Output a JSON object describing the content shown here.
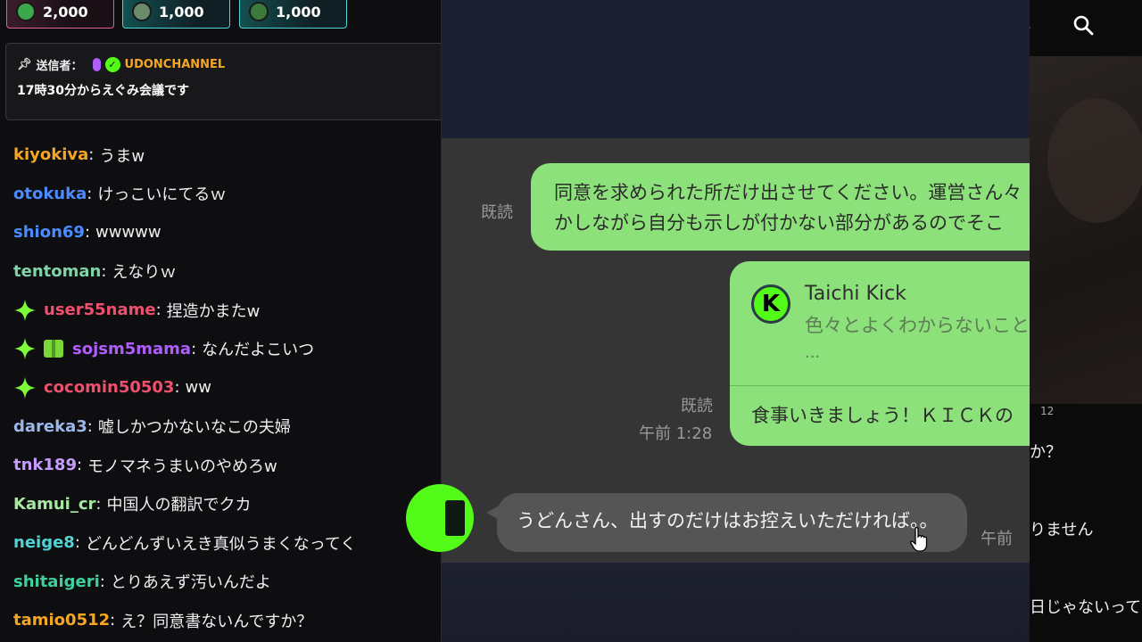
{
  "gifts": [
    {
      "amount": "2,000",
      "icon": "avatar-icon"
    },
    {
      "amount": "1,000",
      "icon": "avatar-icon"
    },
    {
      "amount": "1,000",
      "icon": "avatar-icon"
    }
  ],
  "pinned": {
    "label": "送信者：",
    "sender": "UDONCHANNEL",
    "text": "17時30分からえぐみ会議です"
  },
  "messages": [
    {
      "user": "kiyokiva",
      "color": "#f5a623",
      "text": "うまw",
      "badges": []
    },
    {
      "user": "otokuka",
      "color": "#4a8cff",
      "text": "けっこいにてるｗ",
      "badges": []
    },
    {
      "user": "shion69",
      "color": "#4a8cff",
      "text": "wwwww",
      "badges": []
    },
    {
      "user": "tentoman",
      "color": "#7fd4a8",
      "text": "えなりｗ",
      "badges": []
    },
    {
      "user": "user55name",
      "color": "#f0506e",
      "text": "捏造かまたw",
      "badges": [
        "sparkle-badge"
      ]
    },
    {
      "user": "sojsm5mama",
      "color": "#b05cff",
      "text": "なんだよこいつ",
      "badges": [
        "sparkle-badge",
        "gift-badge"
      ]
    },
    {
      "user": "cocomin50503",
      "color": "#f0506e",
      "text": "ww",
      "badges": [
        "sparkle-badge"
      ]
    },
    {
      "user": "dareka3",
      "color": "#9bb8e8",
      "text": "嘘しかつかないなこの夫婦",
      "badges": []
    },
    {
      "user": "tnk189",
      "color": "#c89cff",
      "text": "モノマネうまいのやめろw",
      "badges": []
    },
    {
      "user": "Kamui_cr",
      "color": "#a6e8a0",
      "text": "中国人の翻訳でクカ",
      "badges": []
    },
    {
      "user": "neige8",
      "color": "#4fd4d4",
      "text": "どんどんずいえき真似うまくなってく",
      "badges": []
    },
    {
      "user": "shitaigeri",
      "color": "#3fcf9f",
      "text": "とりあえず汚いんだよ",
      "badges": []
    },
    {
      "user": "tamio0512",
      "color": "#f5a623",
      "text": "え？同意書ないんですか？",
      "badges": []
    }
  ],
  "line_chat": {
    "msg1_read": "既読",
    "msg1_line1": "同意を求められた所だけ出させてください。運営さん々",
    "msg1_line2": "かしながら自分も示しが付かない部分があるのでそこ",
    "quote_name": "Taichi Kick",
    "quote_text": "色々とよくわからないこと",
    "quote_more": "...",
    "msg2_reply": "食事いきましょう！ＫＩＣＫの",
    "msg2_read": "既読",
    "msg2_time": "午前 1:28",
    "msg3_text": "うどんさん、出すのだけはお控えいただければ。。",
    "msg3_time": "午前"
  },
  "right_panel": {
    "count": "12",
    "line1": "か？",
    "line2": "りません",
    "line3": "日じゃないって"
  }
}
